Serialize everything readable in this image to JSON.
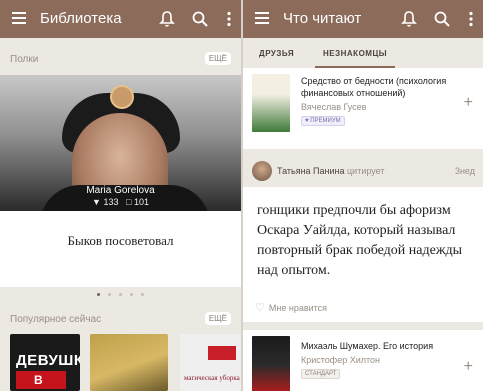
{
  "left": {
    "appbar": {
      "title": "Библиотека"
    },
    "shelves": {
      "label": "Полки",
      "more": "ЕЩЁ"
    },
    "shelf_card": {
      "avatar_name": "Maria Gorelova",
      "stats_books": "133",
      "stats_quotes": "101",
      "title": "Быков посоветовал",
      "carousel_pages": 5,
      "carousel_active": 1
    },
    "popular": {
      "label": "Популярное сейчас",
      "more": "ЕЩЁ"
    },
    "covers": [
      {
        "title": "ДЕВУШКА",
        "subtitle": "В"
      },
      {
        "title": ""
      },
      {
        "title": "магическая уборка"
      }
    ]
  },
  "right": {
    "appbar": {
      "title": "Что читают"
    },
    "tabs": [
      {
        "label": "ДРУЗЬЯ",
        "active": false
      },
      {
        "label": "НЕЗНАКОМЦЫ",
        "active": true
      }
    ],
    "book1": {
      "title": "Средство от бедности (психология финансовых отношений)",
      "author": "Вячеслав Гусев",
      "badge": "ПРЕМИУМ"
    },
    "quote": {
      "user": "Татьяна Панина",
      "verb": "цитирует",
      "time": "3нед",
      "text": "гонщики предпочли бы афоризм Оскара Уайлда, который называл повторный брак победой надежды над опытом.",
      "like_label": "Мне нравится"
    },
    "book2": {
      "title": "Михаэль Шумахер. Его история",
      "author": "Кристофер Хилтон",
      "badge": "СТАНДАРТ"
    }
  },
  "colors": {
    "accent": "#8c6b5a",
    "background": "#ece8e2"
  }
}
